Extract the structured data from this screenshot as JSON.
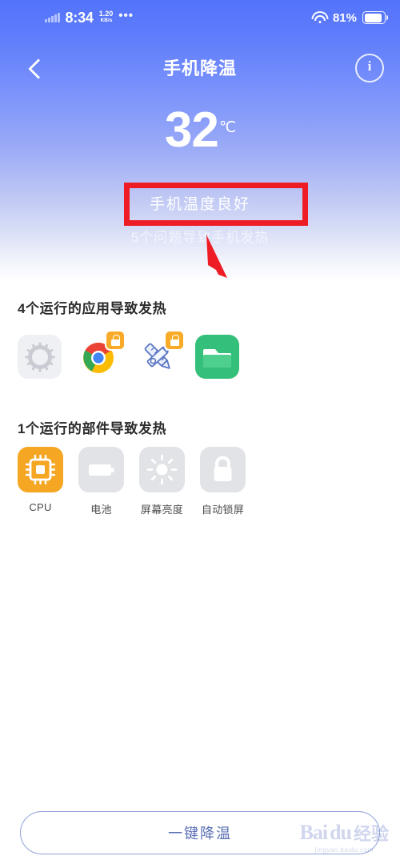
{
  "status_bar": {
    "time": "8:34",
    "net_speed_value": "1.20",
    "net_speed_unit": "KB/s",
    "overflow_dots": "•••",
    "battery_percent": "81%",
    "signal_icon": "signal-bars-icon",
    "wifi_icon": "wifi-icon",
    "battery_icon": "battery-icon"
  },
  "navbar": {
    "back_icon": "back-chevron-icon",
    "title": "手机降温",
    "info_icon": "info-circle-icon",
    "info_glyph": "i"
  },
  "hero": {
    "temperature": "32",
    "temperature_unit": "℃",
    "status_text": "手机温度良好",
    "sub_text": "5个问题导致手机发热"
  },
  "apps_section": {
    "title": "4个运行的应用导致发热",
    "items": [
      {
        "icon": "settings-gear-icon",
        "locked": false
      },
      {
        "icon": "chrome-browser-icon",
        "locked": true
      },
      {
        "icon": "design-tools-icon",
        "locked": true
      },
      {
        "icon": "file-folder-icon",
        "locked": false
      }
    ]
  },
  "parts_section": {
    "title": "1个运行的部件导致发热",
    "items": [
      {
        "label": "CPU",
        "icon": "cpu-chip-icon",
        "active": true
      },
      {
        "label": "电池",
        "icon": "battery-icon",
        "active": false
      },
      {
        "label": "屏幕亮度",
        "icon": "brightness-sun-icon",
        "active": false
      },
      {
        "label": "自动锁屏",
        "icon": "lock-icon",
        "active": false
      }
    ]
  },
  "footer": {
    "cool_button_label": "一键降温"
  },
  "watermark": {
    "brand": "Bai",
    "brand2": "du",
    "cn": "经验",
    "url": "jingyan.baidu.com"
  },
  "annotation": {
    "box_color": "#ee1c25",
    "arrow_color": "#ee1c25",
    "highlighted_text": "手机温度良好"
  },
  "colors": {
    "gradient_top": "#5373fb",
    "gradient_bottom": "#ffffff",
    "accent_orange": "#f5a623",
    "button_border": "#8fa2d8",
    "button_text": "#5a6fb5",
    "tile_gray": "#e1e3e7"
  }
}
